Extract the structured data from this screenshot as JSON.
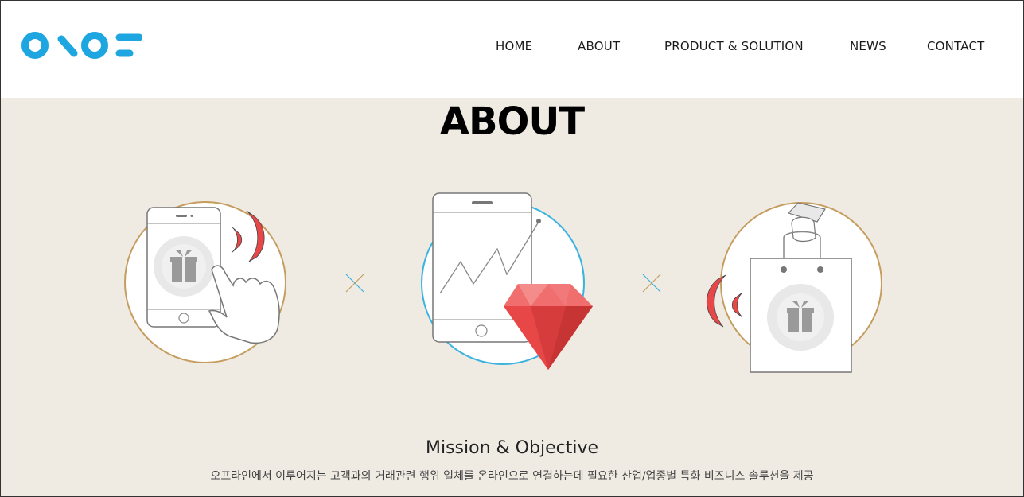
{
  "brand": {
    "logo_text": "ONOF",
    "logo_color": "#1ea6e0"
  },
  "nav": {
    "items": [
      "HOME",
      "ABOUT",
      "PRODUCT & SOLUTION",
      "NEWS",
      "CONTACT"
    ]
  },
  "about": {
    "title": "ABOUT",
    "mission_title": "Mission & Objective",
    "mission_text": "오프라인에서 이루어지는 고객과의 거래관련 행위 일체를 온라인으로 연결하는데 필요한 산업/업종별 특화 비즈니스 솔루션을 제공"
  },
  "colors": {
    "background": "#efebe3",
    "accent_red": "#e84747",
    "circle_gold": "#c59d5f",
    "circle_blue": "#3bb3e0"
  },
  "icons": [
    "phone-gift-icon",
    "tablet-chart-diamond-icon",
    "shopping-bag-icon",
    "cross-icon"
  ]
}
